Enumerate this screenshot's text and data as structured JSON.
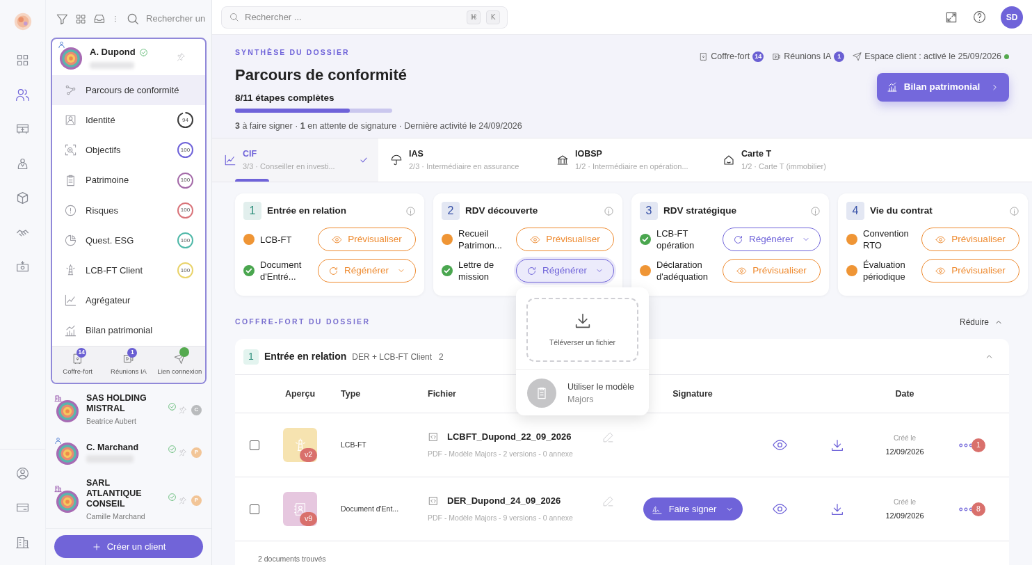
{
  "rail": {
    "items": [
      {
        "kind": "dashboard",
        "selected": false
      },
      {
        "kind": "clients",
        "selected": true
      },
      {
        "kind": "catalog",
        "selected": false
      },
      {
        "kind": "advisor",
        "selected": false
      },
      {
        "kind": "products",
        "selected": false
      },
      {
        "kind": "partners",
        "selected": false
      },
      {
        "kind": "money",
        "selected": false
      }
    ],
    "bottom_items": [
      {
        "kind": "account",
        "selected": false
      },
      {
        "kind": "billing",
        "selected": false
      },
      {
        "kind": "company",
        "selected": false
      }
    ]
  },
  "clients_panel": {
    "search": {
      "placeholder": "Rechercher un"
    },
    "active_client": {
      "name": "A. Dupond",
      "kind": "person",
      "verified": true,
      "menu": [
        {
          "kind": "route",
          "label": "Parcours de conformité",
          "selected": true
        },
        {
          "kind": "identity",
          "label": "Identité",
          "selected": false,
          "score": "94",
          "level": 0.94,
          "color": "#3a3a3a"
        },
        {
          "kind": "objectives",
          "label": "Objectifs",
          "selected": false,
          "score": "100",
          "level": 1,
          "color": "#6f63d9"
        },
        {
          "kind": "clipboard",
          "label": "Patrimoine",
          "selected": false,
          "score": "100",
          "level": 1,
          "color": "#a46aa8"
        },
        {
          "kind": "alert",
          "label": "Risques",
          "selected": false,
          "score": "100",
          "level": 1,
          "color": "#d9747a"
        },
        {
          "kind": "pie",
          "label": "Quest. ESG",
          "selected": false,
          "score": "100",
          "level": 1,
          "color": "#4fb8a8"
        },
        {
          "kind": "lighthouse",
          "label": "LCB-FT Client",
          "selected": false,
          "score": "100",
          "level": 1,
          "color": "#e9d36a"
        },
        {
          "kind": "chart",
          "label": "Agrégateur",
          "selected": false
        },
        {
          "kind": "bars",
          "label": "Bilan patrimonial",
          "selected": false
        }
      ],
      "shortcuts": [
        {
          "kind": "vault",
          "label": "Coffre-fort",
          "badge": "14"
        },
        {
          "kind": "meeting",
          "label": "Réunions IA",
          "badge": "1"
        },
        {
          "kind": "link",
          "label": "Lien connexion",
          "online": true
        }
      ]
    },
    "clients": [
      {
        "name": "SAS HOLDING MISTRAL",
        "subtitle": "Beatrice Aubert",
        "kind": "company",
        "verified": true,
        "initial": "C",
        "color": "#b9bbbd"
      },
      {
        "name": "C. Marchand",
        "kind": "person",
        "verified": true,
        "initial": "P",
        "color": "#f2c597"
      },
      {
        "name": "SARL ATLANTIQUE CONSEIL",
        "subtitle": "Camille Marchand",
        "kind": "company",
        "verified": true,
        "initial": "P",
        "color": "#f2c597"
      }
    ],
    "create_button": "Créer un client"
  },
  "topbar": {
    "search": {
      "placeholder": "Rechercher ..."
    },
    "shortcut_keys": [
      "⌘",
      "K"
    ],
    "avatar": "SD"
  },
  "header": {
    "eyebrow": "SYNTHÈSE DU DOSSIER",
    "title": "Parcours de conformité",
    "progress_label": "8/11 étapes complètes",
    "level": 0.73,
    "summary": "**3** à faire signer · **1** en attente de signature · Dernière activité le 24/09/2026",
    "links": [
      {
        "kind": "vault",
        "label": "Coffre-fort",
        "badge": "14"
      },
      {
        "kind": "meeting",
        "label": "Réunions IA",
        "badge": "1"
      },
      {
        "kind": "portal",
        "label": "Espace client : activé le 25/09/2026",
        "online": true
      }
    ],
    "button": "Bilan patrimonial"
  },
  "tabs": [
    {
      "kind": "chart",
      "code": "CIF",
      "subtitle": "3/3 · Conseiller en investi...",
      "selected": true,
      "done": true
    },
    {
      "kind": "umbrella",
      "code": "IAS",
      "subtitle": "2/3 · Intermédiaire en assurance",
      "selected": false,
      "done": false
    },
    {
      "kind": "bank",
      "code": "IOBSP",
      "subtitle": "1/2 · Intermédiaire en opération...",
      "selected": false,
      "done": false
    },
    {
      "kind": "house",
      "code": "Carte T",
      "subtitle": "1/2 · Carte T (immobilier)",
      "selected": false,
      "done": false
    }
  ],
  "steps": [
    {
      "number": "1",
      "title": "Entrée en relation",
      "color": "#2f8f7c",
      "docs": [
        {
          "label": "LCB-FT",
          "done": false,
          "action": {
            "kind": "preview",
            "label": "Prévisualiser",
            "color": "#ee8a2f"
          }
        },
        {
          "label": "Document d'Entré...",
          "done": true,
          "action": {
            "kind": "regenerate",
            "label": "Régénérer",
            "color": "#ee8a2f"
          }
        }
      ]
    },
    {
      "number": "2",
      "title": "RDV découverte",
      "color": "#3852a8",
      "docs": [
        {
          "label": "Recueil Patrimon...",
          "done": false,
          "action": {
            "kind": "preview",
            "label": "Prévisualiser",
            "color": "#ee8a2f"
          }
        },
        {
          "label": "Lettre de mission",
          "done": true,
          "action": {
            "kind": "regenerate",
            "label": "Régénérer",
            "color": "#6f63d9",
            "open": true,
            "menu": {
              "upload": "Téléverser un fichier",
              "template": "Utiliser le modèle",
              "template_source": "Majors"
            }
          }
        }
      ]
    },
    {
      "number": "3",
      "title": "RDV stratégique",
      "color": "#3852a8",
      "docs": [
        {
          "label": "LCB-FT opération",
          "done": true,
          "action": {
            "kind": "regenerate",
            "label": "Régénérer",
            "color": "#6f63d9"
          }
        },
        {
          "label": "Déclaration d'adéquation",
          "done": false,
          "action": {
            "kind": "preview",
            "label": "Prévisualiser",
            "color": "#ee8a2f"
          }
        }
      ]
    },
    {
      "number": "4",
      "title": "Vie du contrat",
      "color": "#3852a8",
      "docs": [
        {
          "label": "Convention RTO",
          "done": false,
          "action": {
            "kind": "preview",
            "label": "Prévisualiser",
            "color": "#ee8a2f"
          }
        },
        {
          "label": "Évaluation périodique",
          "done": false,
          "action": {
            "kind": "preview",
            "label": "Prévisualiser",
            "color": "#ee8a2f"
          }
        }
      ]
    }
  ],
  "vault": {
    "heading": "COFFRE-FORT DU DOSSIER",
    "collapse": "Réduire",
    "group": {
      "number": "1",
      "title": "Entrée en relation",
      "subtitle": "DER + LCB-FT Client",
      "count": "2",
      "expanded": true
    },
    "columns": [
      "Aperçu",
      "Type",
      "Fichier",
      "Signature",
      "Date"
    ],
    "rows": [
      {
        "checked": false,
        "kind": "lighthouse",
        "color": "#f6e3b0",
        "version": "v2",
        "type": "LCB-FT",
        "file": "LCBFT_Dupond_22_09_2026",
        "meta": "PDF - Modèle Majors - 2 versions - 0 annexe",
        "created_label": "Créé le",
        "date": "12/09/2026",
        "count": "1"
      },
      {
        "checked": false,
        "kind": "contact",
        "color": "#e6c7df",
        "version": "v9",
        "type": "Document d'Ent...",
        "file": "DER_Dupond_24_09_2026",
        "meta": "PDF - Modèle Majors - 9 versions - 0 annexe",
        "sign_button": "Faire signer",
        "created_label": "Créé le",
        "date": "12/09/2026",
        "count": "8"
      }
    ],
    "footer": "2 documents trouvés"
  }
}
